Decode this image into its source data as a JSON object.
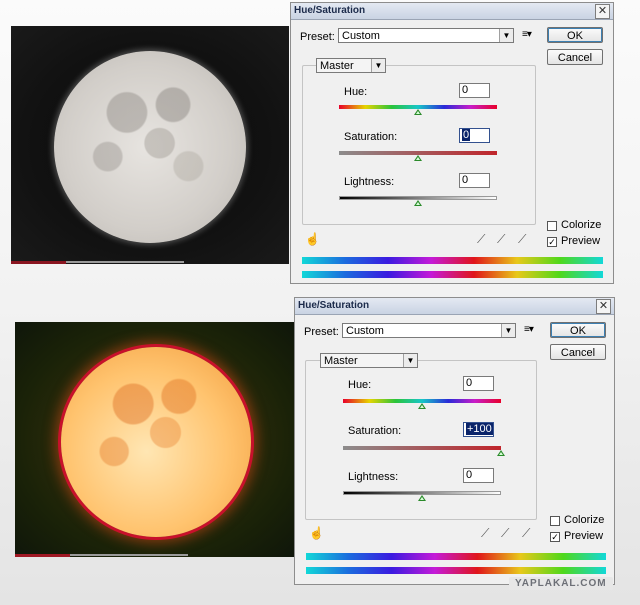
{
  "images": {
    "top": {
      "moon_color": "#d2cec9"
    },
    "bottom": {
      "moon_color": "#ffc36e"
    }
  },
  "dialogs": [
    {
      "title": "Hue/Saturation",
      "preset_label": "Preset:",
      "preset_value": "Custom",
      "ok": "OK",
      "cancel": "Cancel",
      "channel": "Master",
      "hue_label": "Hue:",
      "hue_value": "0",
      "hue_level": 0,
      "saturation_label": "Saturation:",
      "saturation_value": "0",
      "saturation_level": 0,
      "lightness_label": "Lightness:",
      "lightness_value": "0",
      "lightness_level": 0,
      "colorize_label": "Colorize",
      "colorize_checked": false,
      "preview_label": "Preview",
      "preview_checked": true
    },
    {
      "title": "Hue/Saturation",
      "preset_label": "Preset:",
      "preset_value": "Custom",
      "ok": "OK",
      "cancel": "Cancel",
      "channel": "Master",
      "hue_label": "Hue:",
      "hue_value": "0",
      "hue_level": 0,
      "saturation_label": "Saturation:",
      "saturation_value": "+100",
      "saturation_level": 100,
      "lightness_label": "Lightness:",
      "lightness_value": "0",
      "lightness_level": 0,
      "colorize_label": "Colorize",
      "colorize_checked": false,
      "preview_label": "Preview",
      "preview_checked": true
    }
  ],
  "icons": {
    "hand": "hand-adjust-icon",
    "eyedropper": "eyedropper-icon",
    "eyedropper_plus": "eyedropper-plus-icon",
    "eyedropper_minus": "eyedropper-minus-icon",
    "preset_menu": "preset-options-icon"
  },
  "watermark": "YAPLAKAL.COM"
}
